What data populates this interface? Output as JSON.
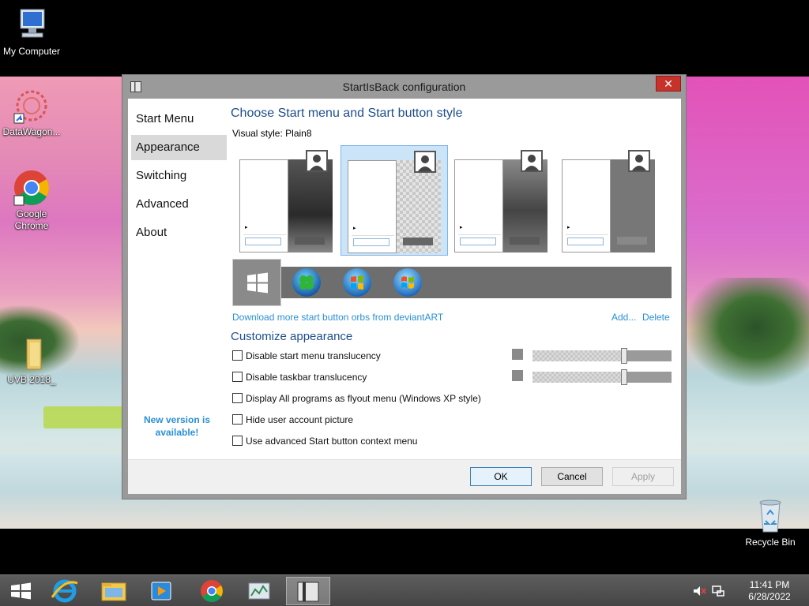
{
  "desktop": {
    "icons": [
      {
        "label": "My Computer",
        "icon": "computer-icon"
      },
      {
        "label": "DataWagon...",
        "icon": "datawagon-icon"
      },
      {
        "label": "Google Chrome",
        "icon": "chrome-icon"
      },
      {
        "label": "UVB 2018_",
        "icon": "folder-icon"
      },
      {
        "label": "Recycle Bin",
        "icon": "recycle-bin-icon"
      }
    ]
  },
  "dialog": {
    "title": "StartIsBack configuration",
    "close_glyph": "✕",
    "nav": [
      "Start Menu",
      "Appearance",
      "Switching",
      "Advanced",
      "About"
    ],
    "selected_nav": "Appearance",
    "new_version": "New version is available!",
    "heading": "Choose Start menu and Start button style",
    "visual_style_label": "Visual style:",
    "visual_style_value": "Plain8",
    "download_link": "Download more start button orbs from deviantART",
    "add_link": "Add...",
    "delete_link": "Delete",
    "customize_heading": "Customize appearance",
    "options": [
      {
        "label": "Disable start menu translucency",
        "checked": false
      },
      {
        "label": "Disable taskbar translucency",
        "checked": false
      },
      {
        "label": "Display All programs as flyout menu (Windows XP style)",
        "checked": false
      },
      {
        "label": "Hide user account picture",
        "checked": false
      },
      {
        "label": "Use advanced Start button context menu",
        "checked": false
      }
    ],
    "buttons": {
      "ok": "OK",
      "cancel": "Cancel",
      "apply": "Apply"
    },
    "orbs": [
      "windows8-orb",
      "clover-orb",
      "windows7-orb",
      "windows7-glass-orb"
    ]
  },
  "taskbar": {
    "items": [
      "start-button",
      "internet-explorer",
      "file-explorer",
      "media-player",
      "chrome",
      "task-manager",
      "startisback-config"
    ],
    "time": "11:41 PM",
    "date": "6/28/2022"
  }
}
